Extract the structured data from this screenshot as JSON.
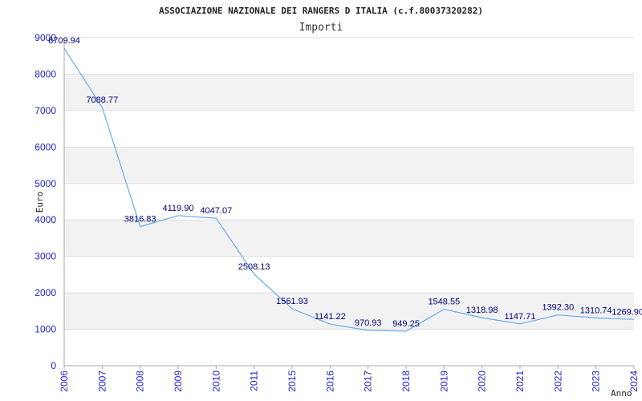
{
  "chart_data": {
    "type": "line",
    "title": "ASSOCIAZIONE NAZIONALE DEI RANGERS D ITALIA (c.f.80037320282)",
    "subtitle": "Importi",
    "xlabel": "Anno",
    "ylabel": "Euro",
    "ylim": [
      0,
      9000
    ],
    "yticks": [
      0,
      1000,
      2000,
      3000,
      4000,
      5000,
      6000,
      7000,
      8000,
      9000
    ],
    "grid": "horizontal bands",
    "categories": [
      "2006",
      "2007",
      "2008",
      "2009",
      "2010",
      "2011",
      "2015",
      "2016",
      "2017",
      "2018",
      "2019",
      "2020",
      "2021",
      "2022",
      "2023",
      "2024"
    ],
    "series": [
      {
        "values": [
          8709.94,
          7088.77,
          3816.83,
          4119.9,
          4047.07,
          2508.13,
          1561.93,
          1141.22,
          970.93,
          949.25,
          1548.55,
          1318.98,
          1147.71,
          1392.3,
          1310.74,
          1269.9
        ],
        "labels": [
          "8709.94",
          "7088.77",
          "3816.83",
          "4119.90",
          "4047.07",
          "2508.13",
          "1561.93",
          "1141.22",
          "970.93",
          "949.25",
          "1548.55",
          "1318.98",
          "1147.71",
          "1392.30",
          "1310.74",
          "1269.90"
        ]
      }
    ],
    "colors": {
      "line": "#66aaee",
      "band": "#f2f2f2",
      "grid": "#dddddd",
      "tick_text": "#1f1fc8",
      "data_label": "#00007a"
    }
  }
}
